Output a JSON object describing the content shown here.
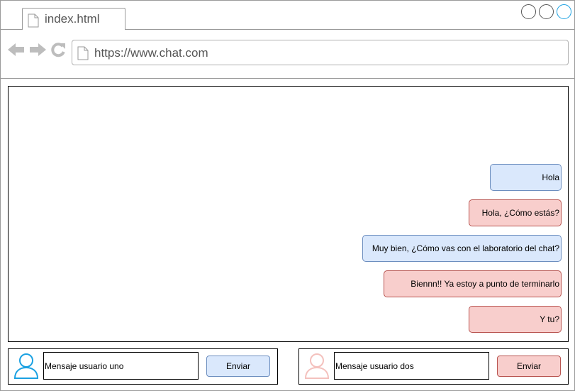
{
  "browser": {
    "tab_title": "index.html",
    "url": "https://www.chat.com",
    "icons": [
      "back-arrow-icon",
      "forward-arrow-icon",
      "refresh-icon",
      "page-icon"
    ],
    "window_controls": [
      "minimize",
      "maximize",
      "close"
    ]
  },
  "chat": {
    "messages": [
      {
        "sender": "usuario uno",
        "text": "Hola",
        "color": "#dae8fc"
      },
      {
        "sender": "usuario dos",
        "text": "Hola, ¿Cómo estás?",
        "color": "#f8cecc"
      },
      {
        "sender": "usuario uno",
        "text": "Muy bien, ¿Cómo vas con el laboratorio del chat?",
        "color": "#dae8fc"
      },
      {
        "sender": "usuario dos",
        "text": "Biennn!! Ya estoy a punto de terminarlo",
        "color": "#f8cecc"
      },
      {
        "sender": "usuario dos",
        "text": "Y tu?",
        "color": "#f8cecc"
      }
    ]
  },
  "user_one": {
    "input_placeholder": "Mensaje usuario uno",
    "send_label": "Enviar",
    "avatar_color": "#1ba1e2",
    "button_color": "#dae8fc"
  },
  "user_two": {
    "input_placeholder": "Mensaje usuario dos",
    "send_label": "Enviar",
    "avatar_color": "#f8cecc",
    "button_color": "#f8cecc"
  }
}
